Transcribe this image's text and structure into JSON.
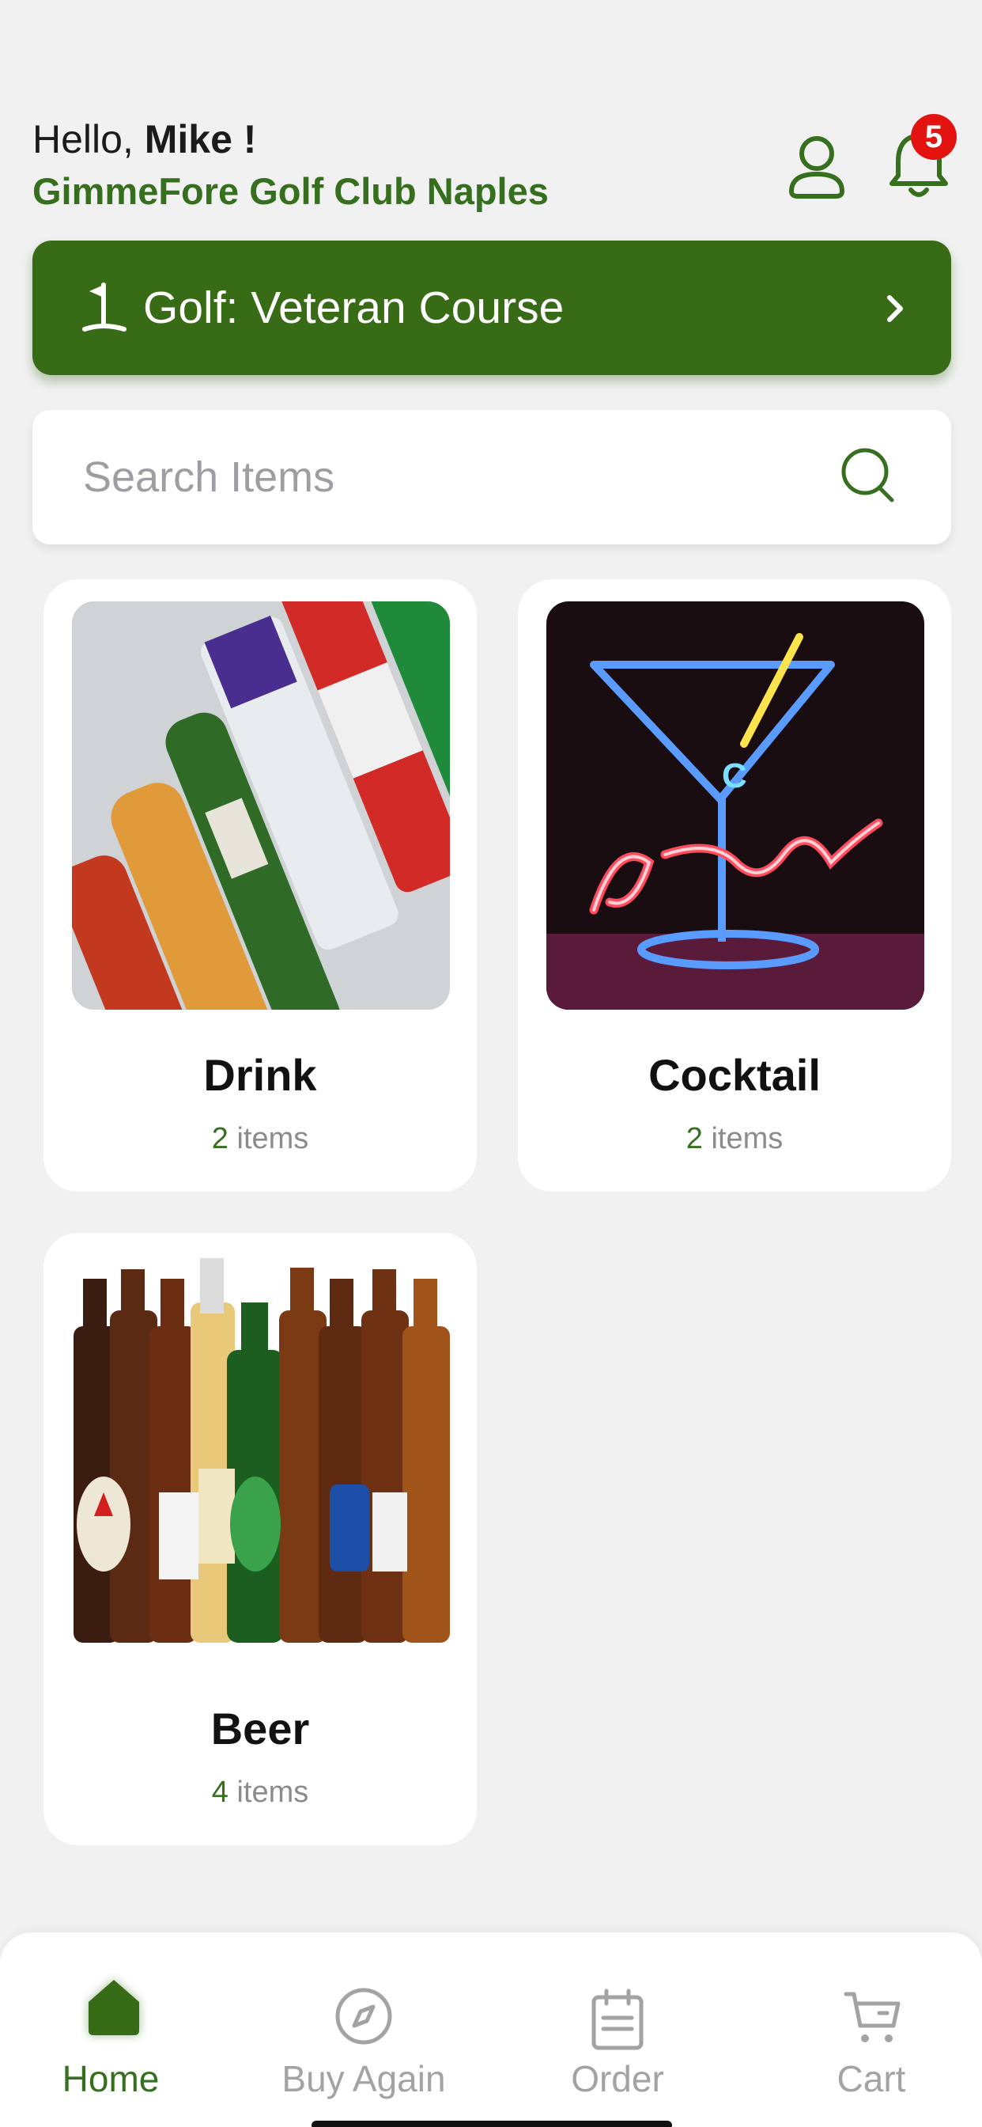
{
  "header": {
    "greeting_prefix": "Hello, ",
    "user_name": "Mike !",
    "club_name": "GimmeFore Golf Club Naples",
    "notification_count": "5"
  },
  "course_banner": {
    "label": "Golf: Veteran Course",
    "icon": "golf-flag-icon"
  },
  "search": {
    "placeholder": "Search Items",
    "value": ""
  },
  "categories": [
    {
      "name": "Drink",
      "count": "2",
      "count_suffix": "items",
      "image": "assorted-drink-bottles-and-cans-photo"
    },
    {
      "name": "Cocktail",
      "count": "2",
      "count_suffix": "items",
      "image": "neon-cocktails-sign-photo"
    },
    {
      "name": "Beer",
      "count": "4",
      "count_suffix": "items",
      "image": "row-of-beer-bottles-photo"
    }
  ],
  "bottom_nav": [
    {
      "label": "Home",
      "icon": "home-icon",
      "active": true
    },
    {
      "label": "Buy Again",
      "icon": "compass-icon",
      "active": false
    },
    {
      "label": "Order",
      "icon": "clipboard-icon",
      "active": false
    },
    {
      "label": "Cart",
      "icon": "cart-icon",
      "active": false
    }
  ],
  "colors": {
    "brand_green": "#386b16",
    "text_green": "#36701f",
    "badge_red": "#e3130f",
    "background": "#f1f1f2",
    "inactive_gray": "#a3a3a3"
  }
}
